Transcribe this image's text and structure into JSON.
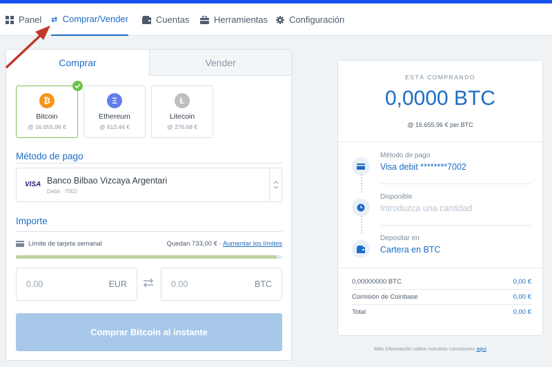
{
  "nav": {
    "items": [
      {
        "label": "Panel",
        "icon": "grid-icon"
      },
      {
        "label": "Comprar/Vender",
        "icon": "swap-icon"
      },
      {
        "label": "Cuentas",
        "icon": "wallet-icon"
      },
      {
        "label": "Herramientas",
        "icon": "toolbox-icon"
      },
      {
        "label": "Configuración",
        "icon": "gear-icon"
      }
    ]
  },
  "tabs": {
    "buy": "Comprar",
    "sell": "Vender"
  },
  "coins": [
    {
      "name": "Bitcoin",
      "price": "@ 16.655,96 €",
      "symbol": "₿",
      "color": "#f7931a"
    },
    {
      "name": "Ethereum",
      "price": "@ 613,44 €",
      "symbol": "Ξ",
      "color": "#627eea"
    },
    {
      "name": "Litecoin",
      "price": "@ 276,68 €",
      "symbol": "Ł",
      "color": "#bebebe"
    }
  ],
  "payment": {
    "title": "Método de pago",
    "card_brand": "VISA",
    "bank_name": "Banco Bilbao Vizcaya Argentari",
    "bank_sub": "Debit · 7002"
  },
  "amount": {
    "title": "Importe",
    "limit_label": "Límite de tarjeta semanal",
    "remaining": "Quedan 733,00 €",
    "separator": "·",
    "increase_link": "Aumentar los límites",
    "limit_used_fraction": 0.98,
    "eur_value": "0.00",
    "eur_currency": "EUR",
    "btc_value": "0.00",
    "btc_currency": "BTC"
  },
  "buy_button": "Comprar Bitcoin al instante",
  "summary": {
    "buying_label": "ESTÁ COMPRANDO",
    "btc_amount": "0,0000 BTC",
    "per_btc": "@ 16.655,96 € per BTC",
    "steps": [
      {
        "label": "Método de pago",
        "value": "Visa debit ********7002"
      },
      {
        "label": "Disponible",
        "value": "Introduzca una cantidad"
      },
      {
        "label": "Depositar en",
        "value": "Cartera en BTC"
      }
    ],
    "fees": [
      {
        "label": "0,00000000 BTC",
        "value": "0,00 €"
      },
      {
        "label": "Comisión de Coinbase",
        "value": "0,00 €"
      },
      {
        "label": "Total",
        "value": "0,00 €"
      }
    ]
  },
  "footer": {
    "text": "Más información sobre nuestras comisiones",
    "link": "aquí"
  },
  "colors": {
    "accent": "#1b6cc4",
    "brand_bar": "#1652f0",
    "annotation_arrow": "#c0392b"
  }
}
